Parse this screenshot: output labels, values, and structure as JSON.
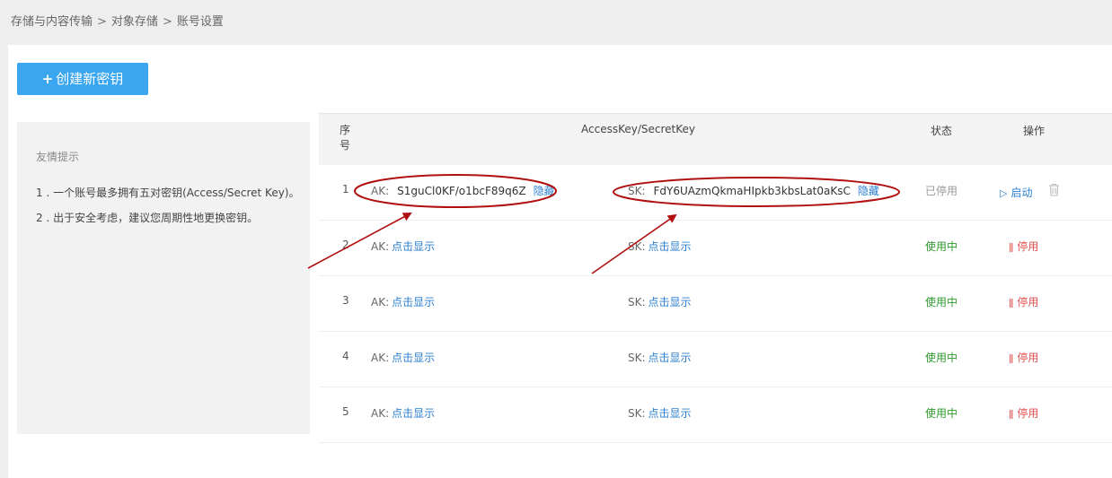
{
  "breadcrumb": {
    "items": [
      "存储与内容传输",
      "对象存储",
      "账号设置"
    ],
    "separator": ">"
  },
  "create_button": {
    "plus": "+",
    "label": "创建新密钥"
  },
  "tips": {
    "title": "友情提示",
    "items": [
      "1 . 一个账号最多拥有五对密钥(Access/Secret Key)。",
      "2 . 出于安全考虑，建议您周期性地更换密钥。"
    ]
  },
  "table": {
    "headers": {
      "index": "序号",
      "key": "AccessKey/SecretKey",
      "status": "状态",
      "operation": "操作"
    },
    "rows": [
      {
        "index": "1",
        "ak_label": "AK:",
        "ak_value": "S1guCl0KF/o1bcF89q6Z",
        "ak_action": "隐藏",
        "sk_label": "SK:",
        "sk_value": "FdY6UAzmQkmaHIpkb3kbsLat0aKsC",
        "sk_action": "隐藏",
        "status": "已停用",
        "operation": "启动"
      },
      {
        "index": "2",
        "ak_label": "AK:",
        "ak_action": "点击显示",
        "sk_label": "SK:",
        "sk_action": "点击显示",
        "status": "使用中",
        "operation": "停用"
      },
      {
        "index": "3",
        "ak_label": "AK:",
        "ak_action": "点击显示",
        "sk_label": "SK:",
        "sk_action": "点击显示",
        "status": "使用中",
        "operation": "停用"
      },
      {
        "index": "4",
        "ak_label": "AK:",
        "ak_action": "点击显示",
        "sk_label": "SK:",
        "sk_action": "点击显示",
        "status": "使用中",
        "operation": "停用"
      },
      {
        "index": "5",
        "ak_label": "AK:",
        "ak_action": "点击显示",
        "sk_label": "SK:",
        "sk_action": "点击显示",
        "status": "使用中",
        "operation": "停用"
      }
    ]
  },
  "icons": {
    "start": "play-icon",
    "stop": "pause-icon",
    "delete": "trash-icon"
  },
  "colors": {
    "primary": "#3aa6f0",
    "link": "#2c7fd1",
    "active": "#2e9a2e",
    "stop": "#e05050",
    "annotation": "#b01010"
  }
}
